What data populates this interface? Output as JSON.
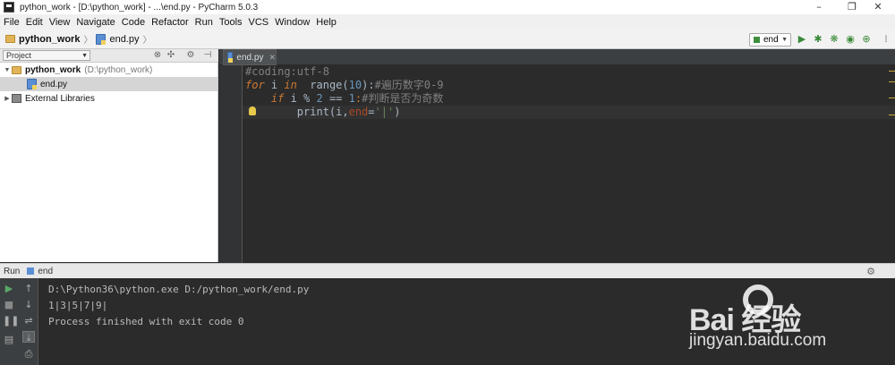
{
  "window": {
    "title": "python_work - [D:\\python_work] - ...\\end.py - PyCharm 5.0.3",
    "minimize": "–",
    "maximize": "❐",
    "close": "✕"
  },
  "menu": [
    "File",
    "Edit",
    "View",
    "Navigate",
    "Code",
    "Refactor",
    "Run",
    "Tools",
    "VCS",
    "Window",
    "Help"
  ],
  "breadcrumb": {
    "project": "python_work",
    "file": "end.py"
  },
  "toolbar": {
    "run_config": "end",
    "icons": [
      "run-icon",
      "debug-icon",
      "coverage-icon",
      "profile-icon",
      "vcs-icon",
      "settings-icon"
    ]
  },
  "project_panel": {
    "view_selector": "Project",
    "tree": [
      {
        "label": "python_work",
        "path": "(D:\\python_work)",
        "expanded": true
      },
      {
        "label": "end.py",
        "selected": true
      },
      {
        "label": "External Libraries",
        "expanded": false
      }
    ]
  },
  "editor": {
    "tab": "end.py",
    "lines": [
      {
        "comment": "#coding:utf-8"
      },
      {
        "kw_for": "for",
        "sp1": " i ",
        "kw_in": "in",
        "sp2": "  range(",
        "n10": "10",
        "close": "):",
        "comment": "#遍历数字0-9"
      },
      {
        "indent": "    ",
        "kw_if": "if",
        "sp1": " i % ",
        "n2": "2",
        "eq": " == ",
        "n1": "1",
        "colon": ":",
        "comment": "#判断是否为奇数"
      },
      {
        "indent": "        ",
        "fn": "print(i,",
        "kwarg": "end",
        "eq": "=",
        "str": "'|'",
        "close": ")"
      }
    ],
    "colors": {
      "background": "#2b2b2b",
      "keyword": "#cc7832",
      "number": "#6897bb",
      "comment": "#808080",
      "string": "#6a8759"
    }
  },
  "run": {
    "label": "Run",
    "config": "end",
    "console": [
      "D:\\Python36\\python.exe D:/python_work/end.py",
      "1|3|5|7|9|",
      "Process finished with exit code 0"
    ]
  },
  "watermark": {
    "brand": "Bai  经验",
    "url": "jingyan.baidu.com"
  }
}
